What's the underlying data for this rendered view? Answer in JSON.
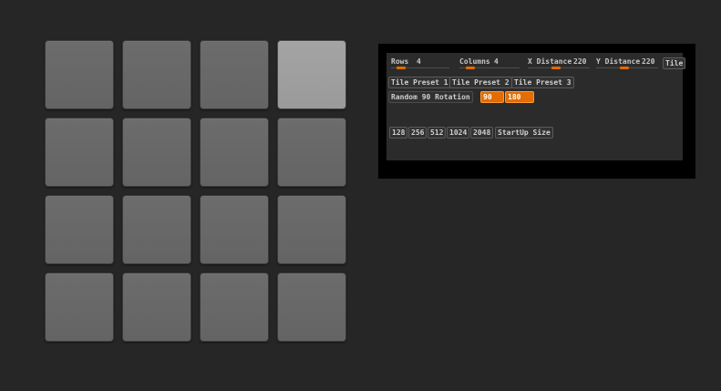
{
  "tiles": {
    "rows": 4,
    "columns": 4,
    "selected_index": 3
  },
  "panel": {
    "sliders": {
      "rows": {
        "label": "Rows",
        "value": "4",
        "level": 0.12
      },
      "columns": {
        "label": "Columns",
        "value": "4",
        "level": 0.12
      },
      "x_distance": {
        "label": "X Distance",
        "value": "220",
        "level": 0.45
      },
      "y_distance": {
        "label": "Y Distance",
        "value": "220",
        "level": 0.45
      }
    },
    "tile_button": "Tile",
    "presets": [
      "Tile Preset 1",
      "Tile Preset 2",
      "Tile Preset 3"
    ],
    "rotation": {
      "label": "Random 90 Rotation",
      "option_90": "90",
      "option_180": "180"
    },
    "sizes": [
      "128",
      "256",
      "512",
      "1024",
      "2048"
    ],
    "startup_size": "StartUp Size"
  },
  "colors": {
    "accent": "#e36d00",
    "background": "#262626",
    "tile": "#666666",
    "tile_selected": "#a0a0a0"
  }
}
